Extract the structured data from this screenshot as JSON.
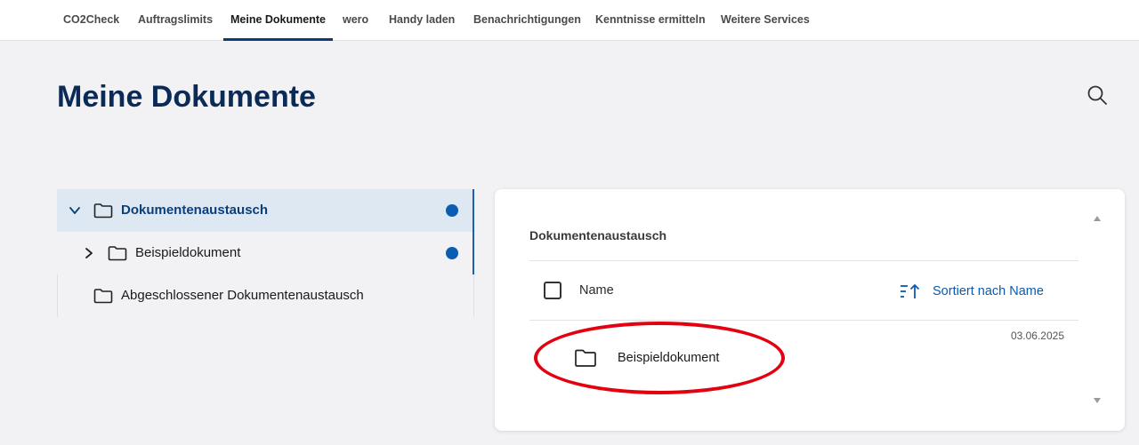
{
  "topnav": {
    "tabs": [
      {
        "label": "CO2Check"
      },
      {
        "label": "Auftragslimits"
      },
      {
        "label": "Meine Dokumente",
        "active": true
      },
      {
        "label": "wero"
      },
      {
        "label": "Handy laden"
      },
      {
        "label": "Benachrichtigungen"
      },
      {
        "label": "Kenntnisse ermitteln"
      },
      {
        "label": "Weitere Services"
      }
    ]
  },
  "page": {
    "title": "Meine Dokumente",
    "search_icon": "search-icon"
  },
  "tree": {
    "items": [
      {
        "label": "Dokumentenaustausch",
        "expanded": true,
        "selected": true,
        "unread": true
      },
      {
        "label": "Beispieldokument",
        "expanded": false,
        "unread": true
      },
      {
        "label": "Abgeschlossener Dokumentenaustausch"
      }
    ]
  },
  "card": {
    "title": "Dokumentenaustausch",
    "header": {
      "name_label": "Name",
      "sort_label": "Sortiert nach Name"
    },
    "rows": [
      {
        "date": "03.06.2025",
        "name": "Beispieldokument"
      }
    ]
  },
  "colors": {
    "accent": "#0a3c78",
    "link": "#0b5ab0",
    "unread_dot": "#0a5db3",
    "highlight": "#e3000f",
    "title": "#0b2a55"
  }
}
